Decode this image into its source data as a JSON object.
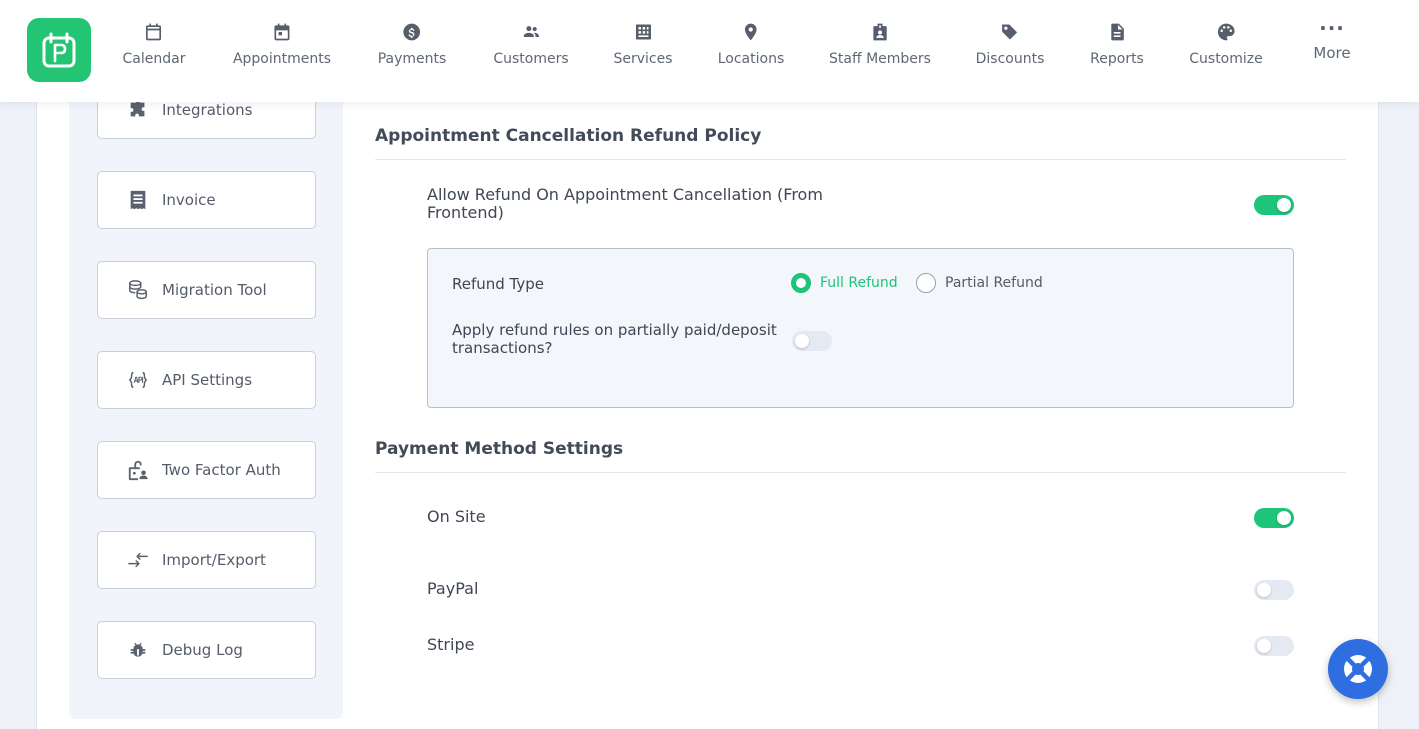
{
  "nav": {
    "items": [
      {
        "label": "Calendar",
        "icon": "calendar-icon"
      },
      {
        "label": "Appointments",
        "icon": "calendar-check-icon"
      },
      {
        "label": "Payments",
        "icon": "dollar-coin-icon"
      },
      {
        "label": "Customers",
        "icon": "users-icon"
      },
      {
        "label": "Services",
        "icon": "services-grid-icon"
      },
      {
        "label": "Locations",
        "icon": "map-pin-icon"
      },
      {
        "label": "Staff Members",
        "icon": "staff-badge-icon"
      },
      {
        "label": "Discounts",
        "icon": "tag-icon"
      },
      {
        "label": "Reports",
        "icon": "report-file-icon"
      },
      {
        "label": "Customize",
        "icon": "palette-icon"
      }
    ],
    "more_label": "More",
    "more_glyph": "···"
  },
  "sidebar": {
    "items": [
      {
        "label": "Integrations",
        "icon": "puzzle-icon"
      },
      {
        "label": "Invoice",
        "icon": "invoice-icon"
      },
      {
        "label": "Migration Tool",
        "icon": "database-icon"
      },
      {
        "label": "API Settings",
        "icon": "api-icon"
      },
      {
        "label": "Two Factor Auth",
        "icon": "lock-user-icon"
      },
      {
        "label": "Import/Export",
        "icon": "arrows-exchange-icon"
      },
      {
        "label": "Debug Log",
        "icon": "bug-icon"
      }
    ]
  },
  "refund_policy": {
    "title": "Appointment Cancellation Refund Policy",
    "allow_label_line1": "Allow Refund On Appointment Cancellation (From",
    "allow_label_line2": "Frontend)",
    "allow_enabled": true,
    "refund_type_label": "Refund Type",
    "options": [
      {
        "label": "Full Refund",
        "selected": true
      },
      {
        "label": "Partial Refund",
        "selected": false
      }
    ],
    "partial_rules_label_line1": "Apply refund rules on partially paid/deposit",
    "partial_rules_label_line2": "transactions?",
    "partial_rules_enabled": false
  },
  "payment_methods": {
    "title": "Payment Method Settings",
    "methods": [
      {
        "label": "On Site",
        "enabled": true
      },
      {
        "label": "PayPal",
        "enabled": false
      },
      {
        "label": "Stripe",
        "enabled": false
      }
    ]
  },
  "colors": {
    "brand_green": "#23c473",
    "toggle_on": "#1ec47a",
    "help_blue": "#2e6ee0"
  }
}
